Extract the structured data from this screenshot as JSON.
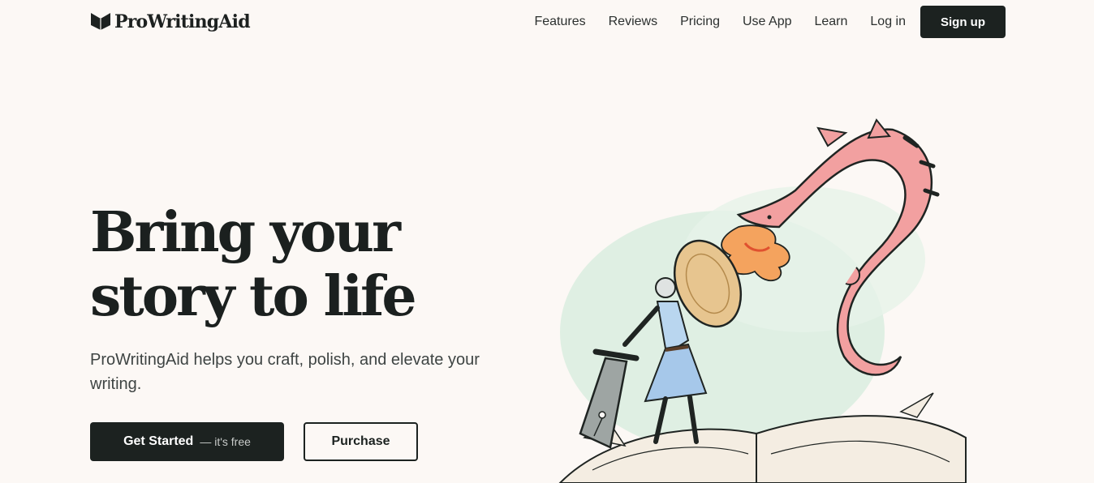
{
  "header": {
    "brand": "ProWritingAid",
    "nav": [
      "Features",
      "Reviews",
      "Pricing",
      "Use App",
      "Learn"
    ],
    "login": "Log in",
    "signup": "Sign up"
  },
  "hero": {
    "title_line1": "Bring your",
    "title_line2": "story to life",
    "subtitle": "ProWritingAid helps you craft, polish, and elevate your writing.",
    "primary_label": "Get Started",
    "primary_sub": "— it's free",
    "secondary_label": "Purchase"
  },
  "illustration": {
    "icon": "knight-fighting-dragon-illustration"
  },
  "colors": {
    "background": "#fcf8f5",
    "dark": "#1c2220",
    "dragon": "#f2a0a0",
    "wash": "#d6ecdc"
  }
}
